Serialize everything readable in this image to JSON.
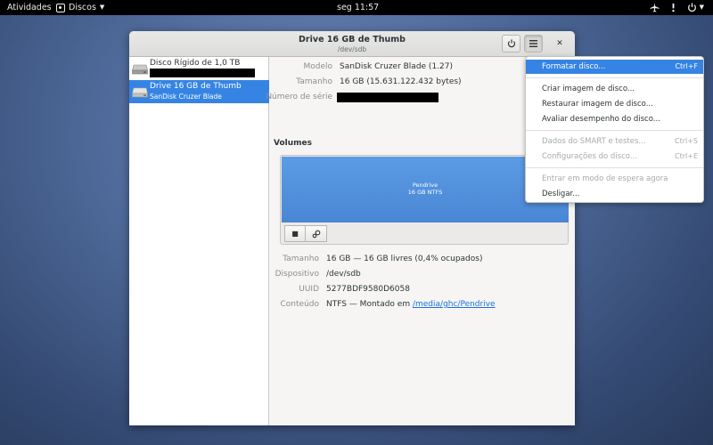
{
  "topbar": {
    "activities": "Atividades",
    "app_name": "Discos",
    "clock": "seg 11:57",
    "icons": [
      "airplane-icon",
      "audio-volume-icon",
      "power-icon"
    ]
  },
  "window": {
    "title": "Drive 16 GB de Thumb",
    "subtitle": "/dev/sdb"
  },
  "sidebar": {
    "disks": [
      {
        "name": "Disco Rígido de 1,0 TB",
        "detail": "",
        "detail_redacted": true
      },
      {
        "name": "Drive 16 GB de Thumb",
        "detail": "SanDisk Cruzer Blade",
        "selected": true
      }
    ]
  },
  "drive": {
    "model_label": "Modelo",
    "model_value": "SanDisk Cruzer Blade (1.27)",
    "size_label": "Tamanho",
    "size_value": "16 GB (15.631.122.432 bytes)",
    "serial_label": "Número de série",
    "serial_redacted": true
  },
  "volumes": {
    "section_title": "Volumes",
    "partition_label": "Pendrive",
    "partition_detail": "16 GB NTFS",
    "size_label": "Tamanho",
    "size_value": "16 GB — 16 GB livres (0,4% ocupados)",
    "device_label": "Dispositivo",
    "device_value": "/dev/sdb",
    "uuid_label": "UUID",
    "uuid_value": "5277BDF9580D6058",
    "contents_label": "Conteúdo",
    "contents_value": "NTFS — Montado em",
    "contents_link": "/media/ghc/Pendrive"
  },
  "menu": {
    "items": [
      {
        "label": "Formatar disco...",
        "shortcut": "Ctrl+F",
        "highlighted": true
      },
      {
        "label": "Criar imagem de disco..."
      },
      {
        "label": "Restaurar imagem de disco..."
      },
      {
        "label": "Avaliar desempenho do disco..."
      },
      {
        "label": "Dados do SMART e testes...",
        "shortcut": "Ctrl+S",
        "disabled": true
      },
      {
        "label": "Configurações do disco...",
        "shortcut": "Ctrl+E",
        "disabled": true
      },
      {
        "label": "Entrar em modo de espera agora",
        "disabled": true
      },
      {
        "label": "Desligar..."
      }
    ]
  }
}
